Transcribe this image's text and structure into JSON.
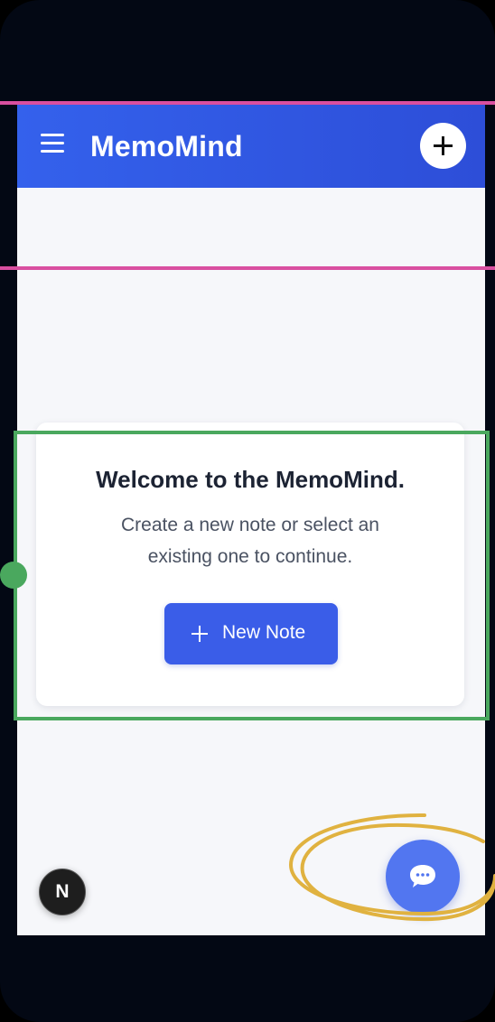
{
  "app": {
    "title": "MemoMind"
  },
  "header": {
    "menu_icon": "hamburger-menu-icon",
    "add_icon": "plus-icon"
  },
  "welcome": {
    "title": "Welcome to the MemoMind.",
    "text": "Create a new note or select an existing one to continue.",
    "button_label": "New Note",
    "button_icon": "plus-icon"
  },
  "badge": {
    "letter": "N"
  },
  "chat": {
    "icon": "chat-bubble-icon"
  },
  "colors": {
    "header": "#2d4ed8",
    "accent": "#3a5de8",
    "background": "#f6f7fa",
    "annotation_magenta": "#d94fa0",
    "annotation_green": "#4aa85e",
    "annotation_gold": "#e0b240"
  }
}
